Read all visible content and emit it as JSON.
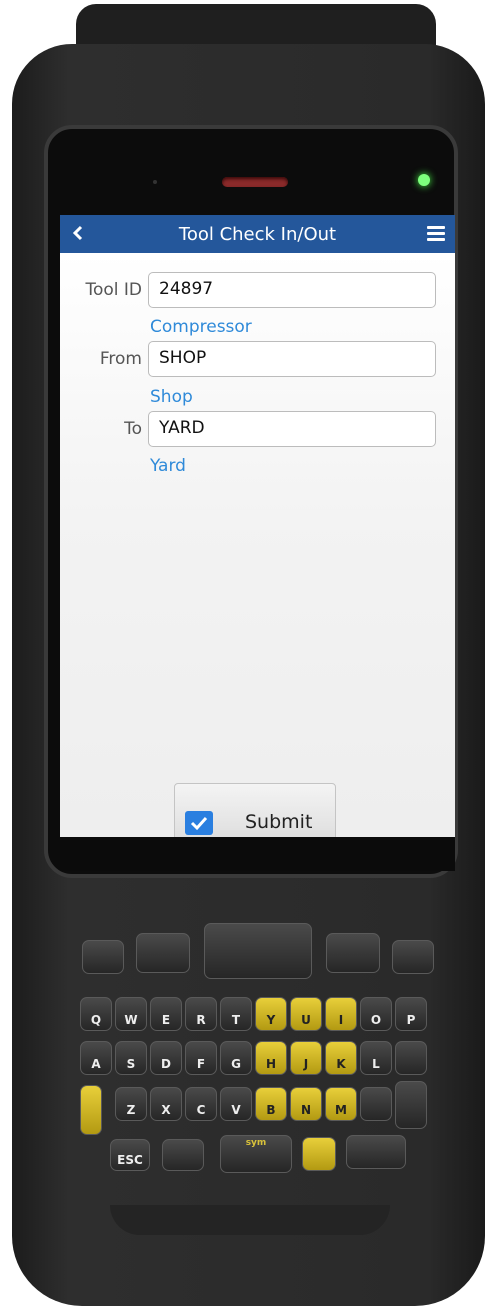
{
  "app": {
    "title": "Tool Check In/Out"
  },
  "form": {
    "tool_id_label": "Tool ID",
    "tool_id_value": "24897",
    "tool_desc": "Compressor",
    "from_label": "From",
    "from_value": "SHOP",
    "from_desc": "Shop",
    "to_label": "To",
    "to_value": "YARD",
    "to_desc": "Yard"
  },
  "actions": {
    "submit_label": "Submit"
  },
  "icons": {
    "back": "chevron-left-icon",
    "menu": "hamburger-menu-icon",
    "submit": "checkmark-icon"
  },
  "colors": {
    "appbar": "#24579b",
    "link_text": "#2f8ad9",
    "led": "#7dff7d"
  },
  "keypad": {
    "row1": [
      "Q",
      "W",
      "E",
      "R",
      "T",
      "Y",
      "U",
      "I",
      "O",
      "P"
    ],
    "row2": [
      "A",
      "S",
      "D",
      "F",
      "G",
      "H",
      "J",
      "K",
      "L"
    ],
    "row3": [
      "Z",
      "X",
      "C",
      "V",
      "B",
      "N",
      "M"
    ],
    "esc": "ESC",
    "sym": "sym"
  }
}
